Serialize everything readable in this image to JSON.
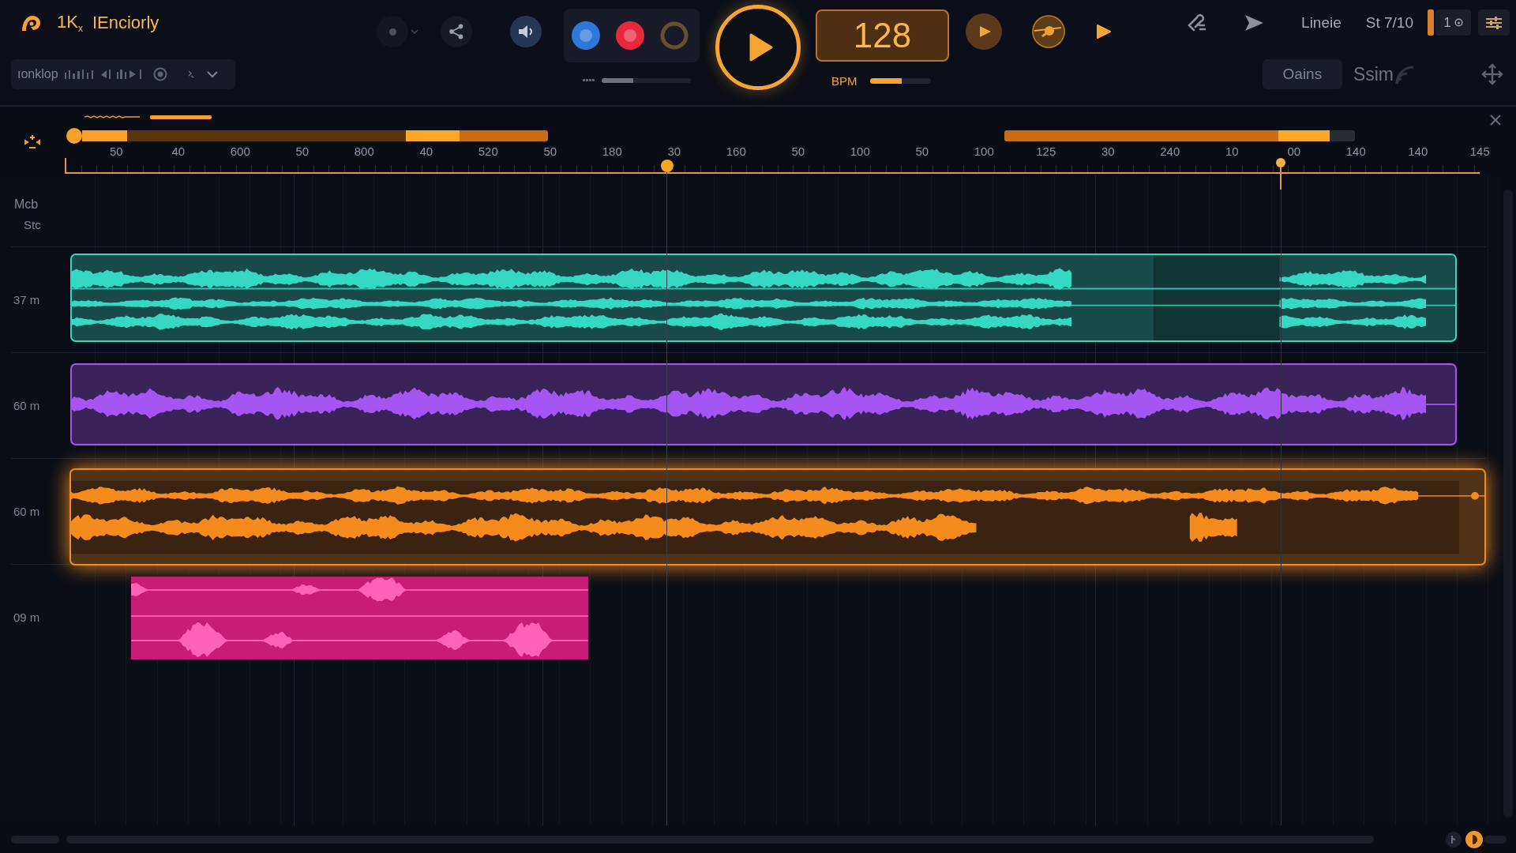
{
  "header": {
    "brand": "1K$_{x}$",
    "title": "IEnciorly",
    "preset": "ıonklop"
  },
  "record_buttons": [
    {
      "kind": "dot",
      "color": "#2f78d8"
    },
    {
      "kind": "dot",
      "color": "#e8283c"
    },
    {
      "kind": "ring",
      "color": "#6b4e2e"
    }
  ],
  "monitor": {
    "level": 0.35
  },
  "tempo": {
    "value": "128",
    "unit": "BPM",
    "level": 0.53
  },
  "status": {
    "mode": "Lineie",
    "position": "St 7/10",
    "counter": "1"
  },
  "view": {
    "button": "Oains",
    "snap": "Ssim"
  },
  "ruler": {
    "labels": [
      "50",
      "40",
      "600",
      "50",
      "800",
      "40",
      "520",
      "50",
      "180",
      "30",
      "160",
      "50",
      "100",
      "50",
      "100",
      "125",
      "30",
      "240",
      "10",
      "00",
      "140",
      "140",
      "145"
    ]
  },
  "track_header": [
    "Mcb",
    "Stc"
  ],
  "tracks": [
    {
      "label": "37 m",
      "kind": "layered",
      "color": "#35d8c0",
      "selected": false
    },
    {
      "label": "60 m",
      "kind": "mono",
      "color": "#a455f2",
      "selected": false
    },
    {
      "label": "60 m",
      "kind": "stereo",
      "color": "#f58a1d",
      "selected": true
    },
    {
      "label": "09 m",
      "kind": "vocal",
      "color": "#c81d74",
      "selected": false
    }
  ]
}
